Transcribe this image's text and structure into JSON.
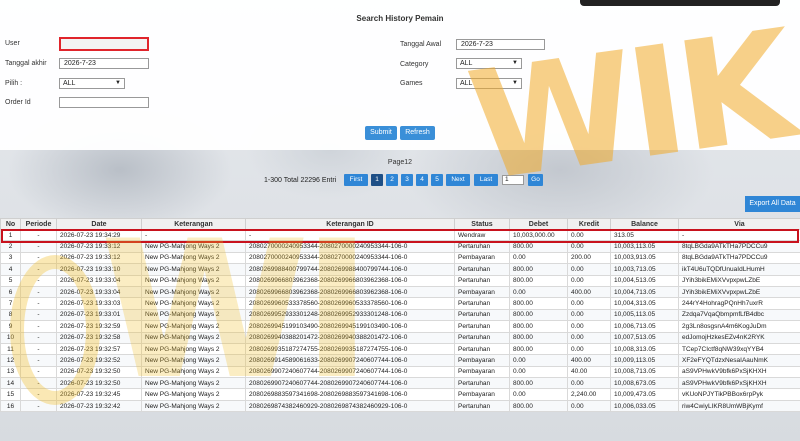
{
  "form": {
    "title": "Search History Pemain",
    "user_label": "User",
    "user_value": "",
    "tanggal_akhir_label": "Tanggal akhir",
    "tanggal_akhir_value": "2026-7-23",
    "pilih_label": "Pilih :",
    "pilih_value": "ALL",
    "order_id_label": "Order Id",
    "order_id_value": "",
    "tanggal_awal_label": "Tanggal Awal",
    "tanggal_awal_value": "2026-7-23",
    "category_label": "Category",
    "category_value": "ALL",
    "games_label": "Games",
    "games_value": "ALL",
    "submit_label": "Submit",
    "refresh_label": "Refresh"
  },
  "pager": {
    "page_title": "Page12",
    "total_text": "1-300 Total 22296 Entri",
    "first": "First",
    "pages": [
      "1",
      "2",
      "3",
      "4",
      "5"
    ],
    "next": "Next",
    "last": "Last",
    "page_input": "1",
    "go": "Go"
  },
  "export_label": "Export All Data",
  "watermark": "WIVALIK",
  "table": {
    "headers": [
      "No",
      "Periode",
      "Date",
      "Keterangan",
      "Keterangan ID",
      "Status",
      "Debet",
      "Kredit",
      "Balance",
      "Via"
    ],
    "rows": [
      [
        "1",
        "-",
        "2026-07-23 19:34:29",
        "-",
        "-",
        "Wendraw",
        "10,003,000.00",
        "0.00",
        "313.05",
        "-"
      ],
      [
        "2",
        "-",
        "2026-07-23 19:33:12",
        "New PG-Mahjong Ways 2",
        "2080270000240953344-2080270000240953344-106-0",
        "Pertaruhan",
        "800.00",
        "0.00",
        "10,003,113.05",
        "8tqLBGda9ATkTHa7PDCCu9"
      ],
      [
        "3",
        "-",
        "2026-07-23 19:33:12",
        "New PG-Mahjong Ways 2",
        "2080270000240953344-2080270000240953344-106-0",
        "Pembayaran",
        "0.00",
        "200.00",
        "10,003,913.05",
        "8tqLBGda9ATkTHa7PDCCu9"
      ],
      [
        "4",
        "-",
        "2026-07-23 19:33:10",
        "New PG-Mahjong Ways 2",
        "2080269988400799744-2080269988400799744-106-0",
        "Pertaruhan",
        "800.00",
        "0.00",
        "10,003,713.05",
        "ikT4U6uTQDfUnuaIdLHumH"
      ],
      [
        "5",
        "-",
        "2026-07-23 19:33:04",
        "New PG-Mahjong Ways 2",
        "2080269966803962368-2080269966803962368-106-0",
        "Pertaruhan",
        "800.00",
        "0.00",
        "10,004,513.05",
        "JYih3bikEMiXVvpxpwLZbE"
      ],
      [
        "6",
        "-",
        "2026-07-23 19:33:04",
        "New PG-Mahjong Ways 2",
        "2080269966803962368-2080269966803962368-106-0",
        "Pembayaran",
        "0.00",
        "400.00",
        "10,004,713.05",
        "JYih3bikEMiXVvpxpwLZbE"
      ],
      [
        "7",
        "-",
        "2026-07-23 19:33:03",
        "New PG-Mahjong Ways 2",
        "2080269960533378560-2080269960533378560-106-0",
        "Pertaruhan",
        "800.00",
        "0.00",
        "10,004,313.05",
        "244rY4HohragPQnHh7uxrR"
      ],
      [
        "8",
        "-",
        "2026-07-23 19:33:01",
        "New PG-Mahjong Ways 2",
        "2080269952933301248-2080269952933301248-106-0",
        "Pertaruhan",
        "800.00",
        "0.00",
        "10,005,113.05",
        "Zzdqa7VqaQbmpmfLfB4dbc"
      ],
      [
        "9",
        "-",
        "2026-07-23 19:32:59",
        "New PG-Mahjong Ways 2",
        "2080269945199103490-2080269945199103490-106-0",
        "Pertaruhan",
        "800.00",
        "0.00",
        "10,006,713.05",
        "2g3Ln8osgsnA4m6KogJuDm"
      ],
      [
        "10",
        "-",
        "2026-07-23 19:32:58",
        "New PG-Mahjong Ways 2",
        "2080269940388201472-2080269940388201472-106-0",
        "Pertaruhan",
        "800.00",
        "0.00",
        "10,007,513.05",
        "edJomojHzkesEZv4nK2RYK"
      ],
      [
        "11",
        "-",
        "2026-07-23 19:32:57",
        "New PG-Mahjong Ways 2",
        "2080269935187274755-2080269935187274755-106-0",
        "Pertaruhan",
        "800.00",
        "0.00",
        "10,008,313.05",
        "TCep7CIctf8qNW39xqYYB4"
      ],
      [
        "12",
        "-",
        "2026-07-23 19:32:52",
        "New PG-Mahjong Ways 2",
        "2080269914589061633-2080269907240607744-106-0",
        "Pembayaran",
        "0.00",
        "400.00",
        "10,009,113.05",
        "XF2eFYQTdzxNesaIAauNmK"
      ],
      [
        "13",
        "-",
        "2026-07-23 19:32:50",
        "New PG-Mahjong Ways 2",
        "2080269907240607744-2080269907240607744-106-0",
        "Pembayaran",
        "0.00",
        "40.00",
        "10,008,713.05",
        "aS9VPHwkV9bfk6PxSjKHXH"
      ],
      [
        "14",
        "-",
        "2026-07-23 19:32:50",
        "New PG-Mahjong Ways 2",
        "2080269907240607744-2080269907240607744-106-0",
        "Pertaruhan",
        "800.00",
        "0.00",
        "10,008,673.05",
        "aS9VPHwkV9bfk6PxSjKHXH"
      ],
      [
        "15",
        "-",
        "2026-07-23 19:32:45",
        "New PG-Mahjong Ways 2",
        "2080269883597341698-2080269883597341698-106-0",
        "Pembayaran",
        "0.00",
        "2,240.00",
        "10,009,473.05",
        "vKUoNPJYTikPBBox6rpPyk"
      ],
      [
        "16",
        "-",
        "2026-07-23 19:32:42",
        "New PG-Mahjong Ways 2",
        "2080269874382460929-2080269874382460929-106-0",
        "Pertaruhan",
        "800.00",
        "0.00",
        "10,006,033.05",
        "riw4CwiyLIKR8UmWBjKymf"
      ]
    ]
  },
  "colors": {
    "accent": "#2f86d6",
    "highlight": "#c8121d",
    "watermark": "#f0aa28"
  }
}
